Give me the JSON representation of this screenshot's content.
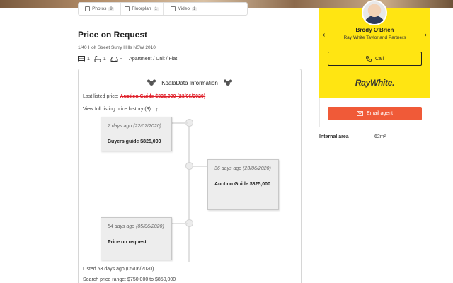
{
  "media_tabs": [
    {
      "label": "Photos",
      "count": "9"
    },
    {
      "label": "Floorplan",
      "count": "1"
    },
    {
      "label": "Video",
      "count": "1"
    },
    {
      "label": "",
      "count": ""
    }
  ],
  "listing": {
    "price": "Price on Request",
    "address": "1/40 Holt Street Surry Hills NSW 2010",
    "beds": "1",
    "baths": "1",
    "cars": "-",
    "property_type": "Apartment / Unit / Flat"
  },
  "koala": {
    "title": "KoalaData Information",
    "last_listed_label": "Last listed price:",
    "last_listed_value": "Auction Guide $825,000 (23/06/2020)",
    "history_link": "View full listing price history (3)",
    "history_arrow": "↑",
    "events": [
      {
        "when": "7 days ago (22/07/2020)",
        "what": "Buyers guide $825,000"
      },
      {
        "when": "36 days ago (23/06/2020)",
        "what": "Auction Guide $825,000"
      },
      {
        "when": "54 days ago (05/06/2020)",
        "what": "Price on request"
      }
    ],
    "listed_days": "Listed 53 days ago (05/06/2020)",
    "search_range": "Search price range: $750,000 to $850,000"
  },
  "agent": {
    "name": "Brody O'Brien",
    "agency": "Ray White Taylor and Partners",
    "prev_arrow": "‹",
    "next_arrow": "›",
    "call_label": "Call",
    "logo_text": "RayWhite.",
    "email_label": "Email agent",
    "brand_color": "#ffe512",
    "email_color": "#f05a38"
  },
  "details": {
    "internal_label": "Internal area",
    "internal_value": "62m²"
  }
}
